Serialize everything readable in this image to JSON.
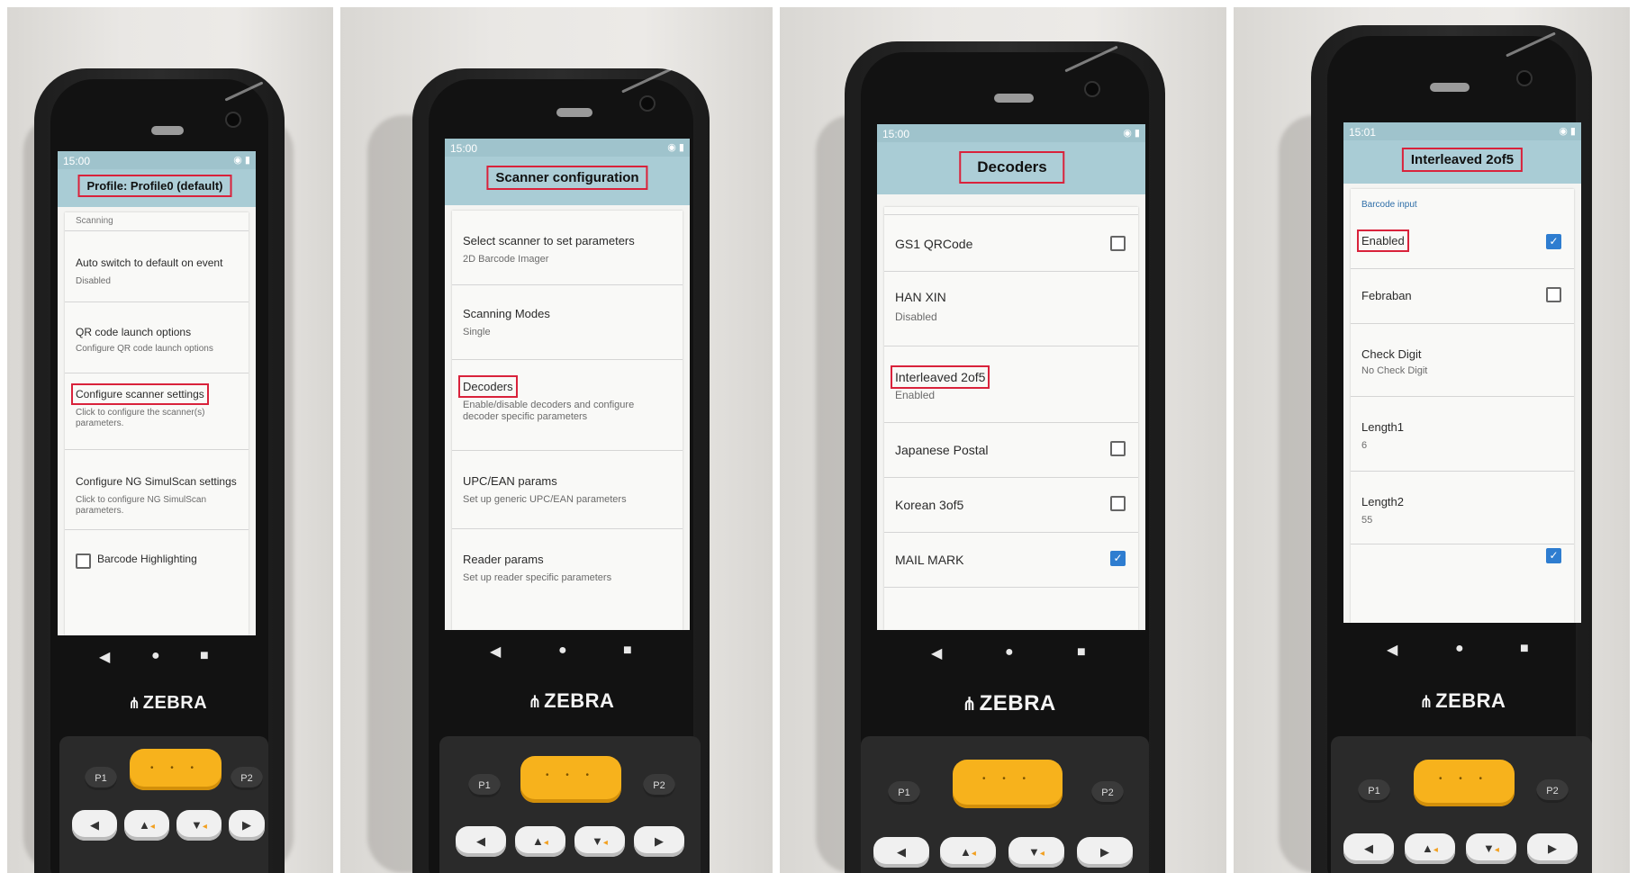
{
  "panel1": {
    "status_time": "15:00",
    "title": "Profile: Profile0 (default)",
    "items": [
      {
        "title": "Scanning"
      },
      {
        "title": "Auto switch to default on event",
        "subtitle": "Disabled"
      },
      {
        "title": "QR code launch options",
        "subtitle": "Configure QR code launch options"
      },
      {
        "title": "Configure scanner settings",
        "subtitle": "Click to configure the scanner(s) parameters."
      },
      {
        "title": "Configure NG SimulScan settings",
        "subtitle": "Click to configure NG SimulScan parameters."
      },
      {
        "title": "Barcode Highlighting"
      }
    ]
  },
  "panel2": {
    "status_time": "15:00",
    "title": "Scanner configuration",
    "items": [
      {
        "title": "Select scanner to set parameters",
        "subtitle": "2D Barcode Imager"
      },
      {
        "title": "Scanning Modes",
        "subtitle": "Single"
      },
      {
        "title": "Decoders",
        "subtitle": "Enable/disable decoders and configure decoder specific parameters"
      },
      {
        "title": "UPC/EAN params",
        "subtitle": "Set up generic UPC/EAN parameters"
      },
      {
        "title": "Reader params",
        "subtitle": "Set up reader specific parameters"
      }
    ]
  },
  "panel3": {
    "status_time": "15:00",
    "title": "Decoders",
    "items": [
      {
        "title": "GS1 QRCode",
        "checked": false
      },
      {
        "title": "HAN XIN",
        "subtitle": "Disabled"
      },
      {
        "title": "Interleaved 2of5",
        "subtitle": "Enabled"
      },
      {
        "title": "Japanese Postal",
        "checked": false
      },
      {
        "title": "Korean 3of5",
        "checked": false
      },
      {
        "title": "MAIL MARK",
        "checked": true
      }
    ]
  },
  "panel4": {
    "status_time": "15:01",
    "title": "Interleaved 2of5",
    "section": "Barcode input",
    "items": [
      {
        "title": "Enabled",
        "checked": true
      },
      {
        "title": "Febraban",
        "checked": false
      },
      {
        "title": "Check Digit",
        "subtitle": "No Check Digit"
      },
      {
        "title": "Length1",
        "subtitle": "6"
      },
      {
        "title": "Length2",
        "subtitle": "55"
      }
    ]
  },
  "device": {
    "brand": "ZEBRA",
    "key_p1": "P1",
    "key_p2": "P2"
  }
}
